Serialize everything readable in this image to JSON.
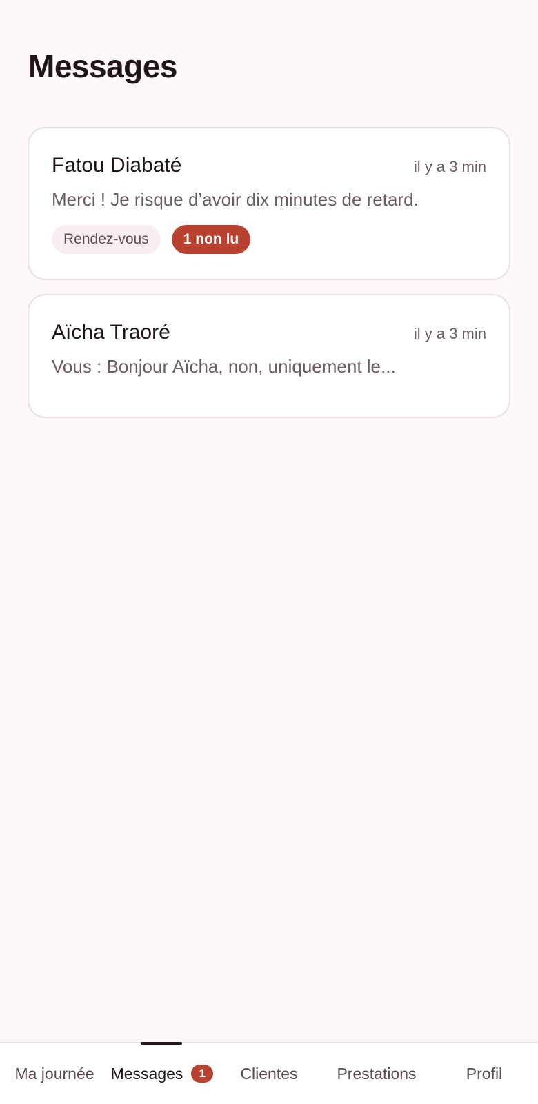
{
  "header": {
    "title": "Messages"
  },
  "conversations": [
    {
      "name": "Fatou Diabaté",
      "time": "il y a 3 min",
      "preview": "Merci ! Je risque d’avoir dix minutes de retard.",
      "tag": "Rendez-vous",
      "unread": "1 non lu"
    },
    {
      "name": "Aïcha Traoré",
      "time": "il y a 3 min",
      "preview": "Vous : Bonjour Aïcha, non, uniquement le..."
    }
  ],
  "nav": {
    "items": [
      {
        "label": "Ma journée"
      },
      {
        "label": "Messages",
        "badge": "1",
        "active": true
      },
      {
        "label": "Clientes"
      },
      {
        "label": "Prestations"
      },
      {
        "label": "Profil"
      }
    ]
  },
  "colors": {
    "background": "#fdf7fa",
    "accent": "#b9412f",
    "text": "#221418",
    "muted": "#6c5c62"
  }
}
